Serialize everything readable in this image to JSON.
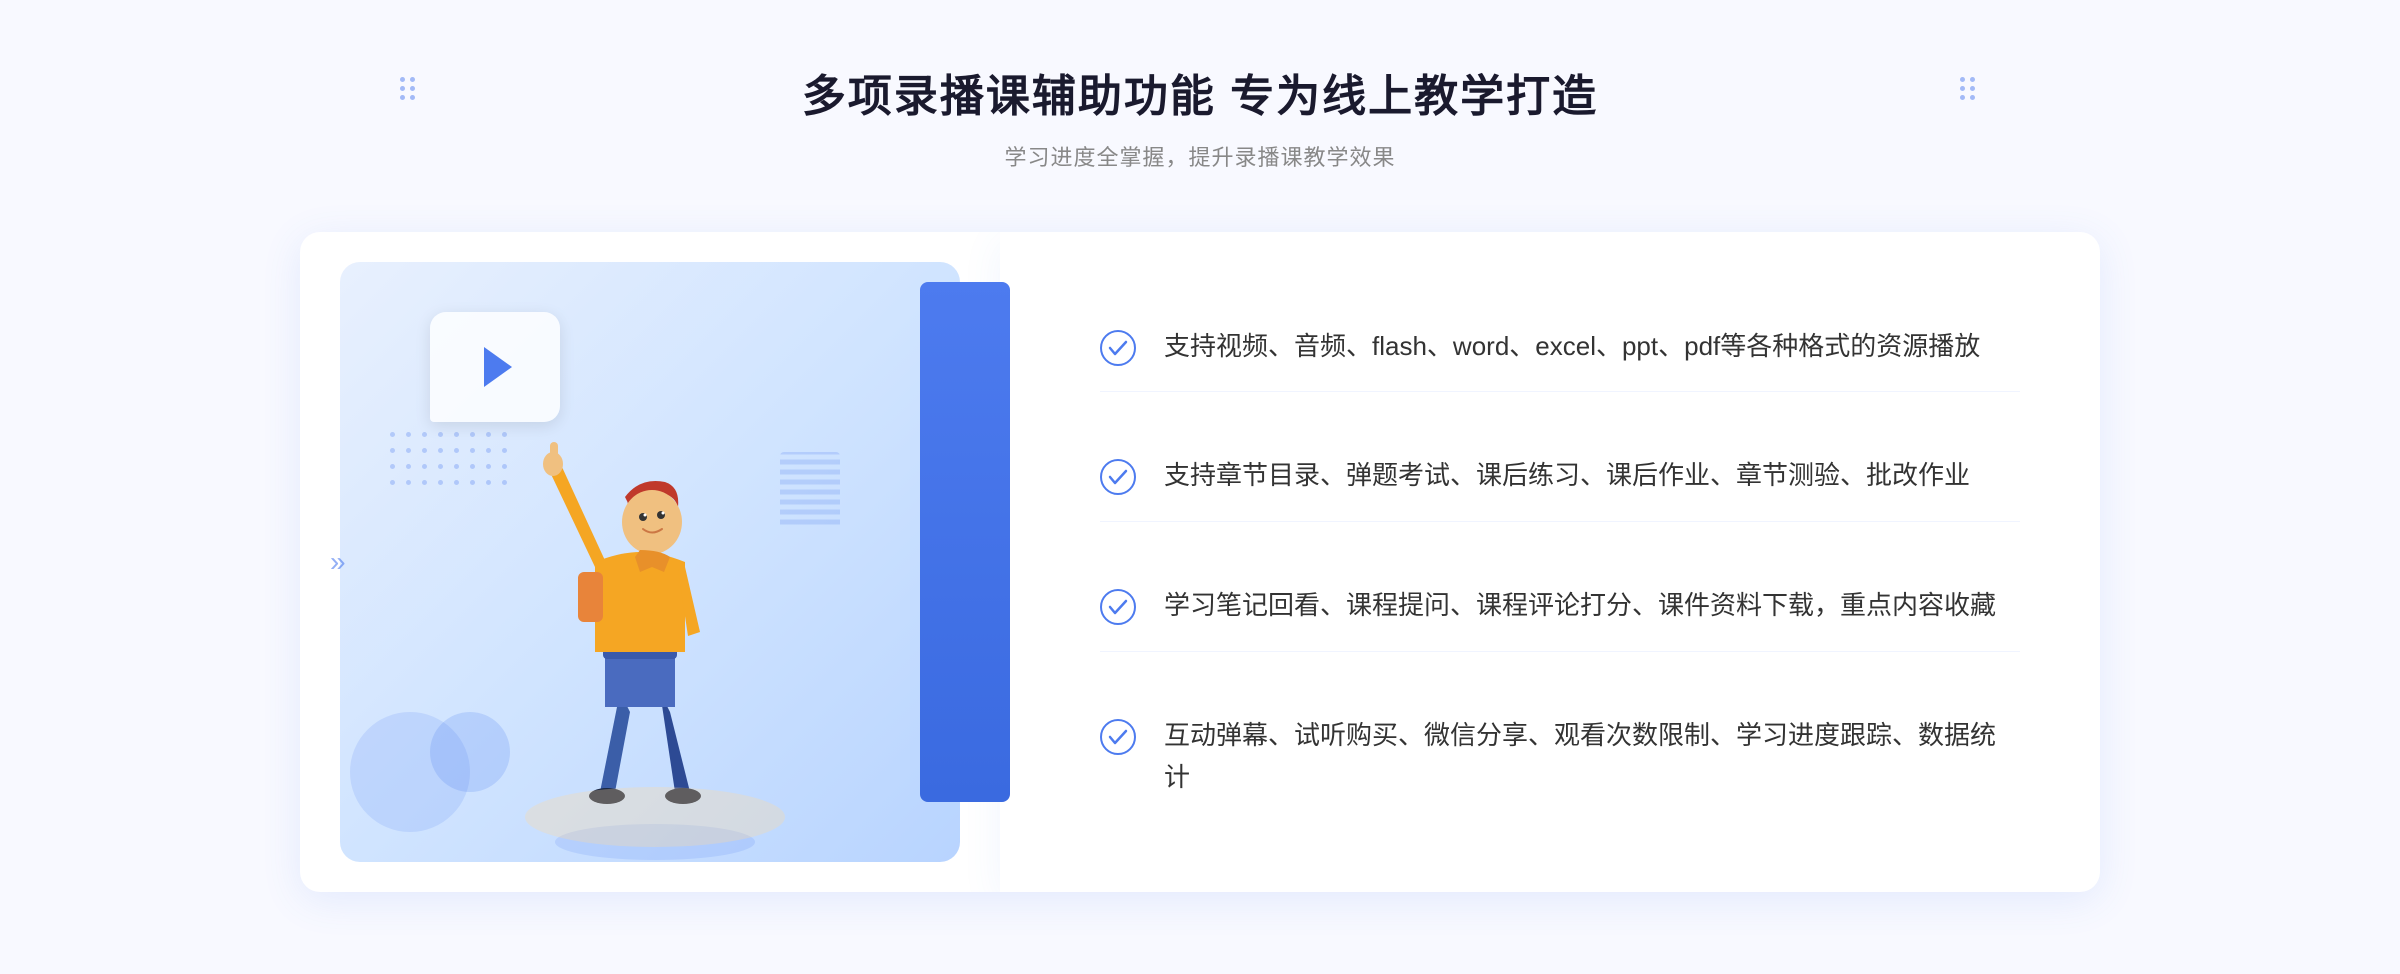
{
  "header": {
    "title": "多项录播课辅助功能 专为线上教学打造",
    "subtitle": "学习进度全掌握，提升录播课教学效果"
  },
  "features": [
    {
      "id": 1,
      "text": "支持视频、音频、flash、word、excel、ppt、pdf等各种格式的资源播放"
    },
    {
      "id": 2,
      "text": "支持章节目录、弹题考试、课后练习、课后作业、章节测验、批改作业"
    },
    {
      "id": 3,
      "text": "学习笔记回看、课程提问、课程评论打分、课件资料下载，重点内容收藏"
    },
    {
      "id": 4,
      "text": "互动弹幕、试听购买、微信分享、观看次数限制、学习进度跟踪、数据统计"
    }
  ],
  "decorations": {
    "arrow_chars": "》",
    "dot_color": "#4d7bef"
  }
}
